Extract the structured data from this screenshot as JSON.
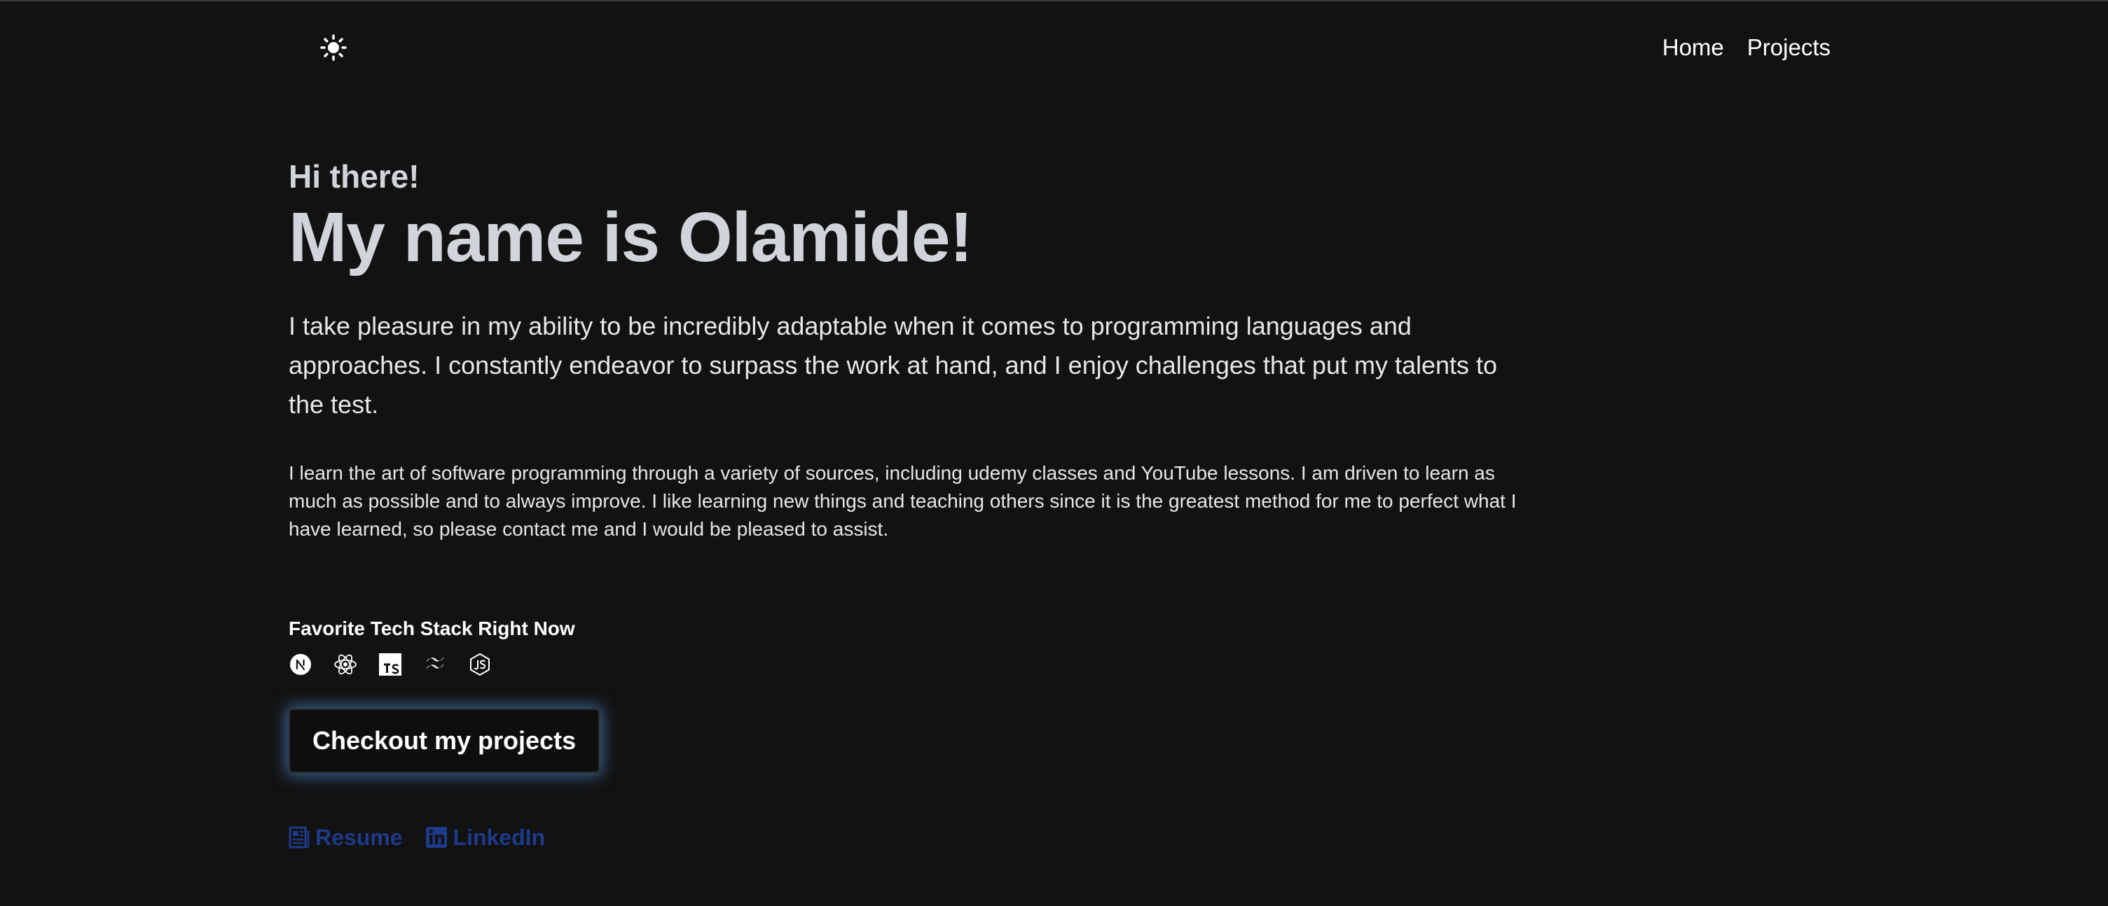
{
  "header": {
    "theme_icon": "sun-icon",
    "nav": [
      {
        "label": "Home"
      },
      {
        "label": "Projects"
      }
    ]
  },
  "hero": {
    "greeting": "Hi there!",
    "name_heading": "My name is Olamide!",
    "lead": "I take pleasure in my ability to be incredibly adaptable when it comes to programming languages and approaches. I constantly endeavor to surpass the work at hand, and I enjoy challenges that put my talents to the test.",
    "body": "I learn the art of software programming through a variety of sources, including udemy classes and YouTube lessons. I am driven to learn as much as possible and to always improve. I like learning new things and teaching others since it is the greatest method for me to perfect what I have learned, so please contact me and I would be pleased to assist."
  },
  "tech_stack": {
    "title": "Favorite Tech Stack Right Now",
    "icons": [
      "nextjs-icon",
      "react-icon",
      "typescript-icon",
      "tailwind-icon",
      "nodejs-icon"
    ]
  },
  "cta": {
    "label": "Checkout my projects"
  },
  "links": {
    "resume_label": "Resume",
    "linkedin_label": "LinkedIn"
  },
  "colors": {
    "background": "#121212",
    "text": "#e5e7eb",
    "link": "#1e3a8a",
    "glow": "#60a5fa"
  }
}
